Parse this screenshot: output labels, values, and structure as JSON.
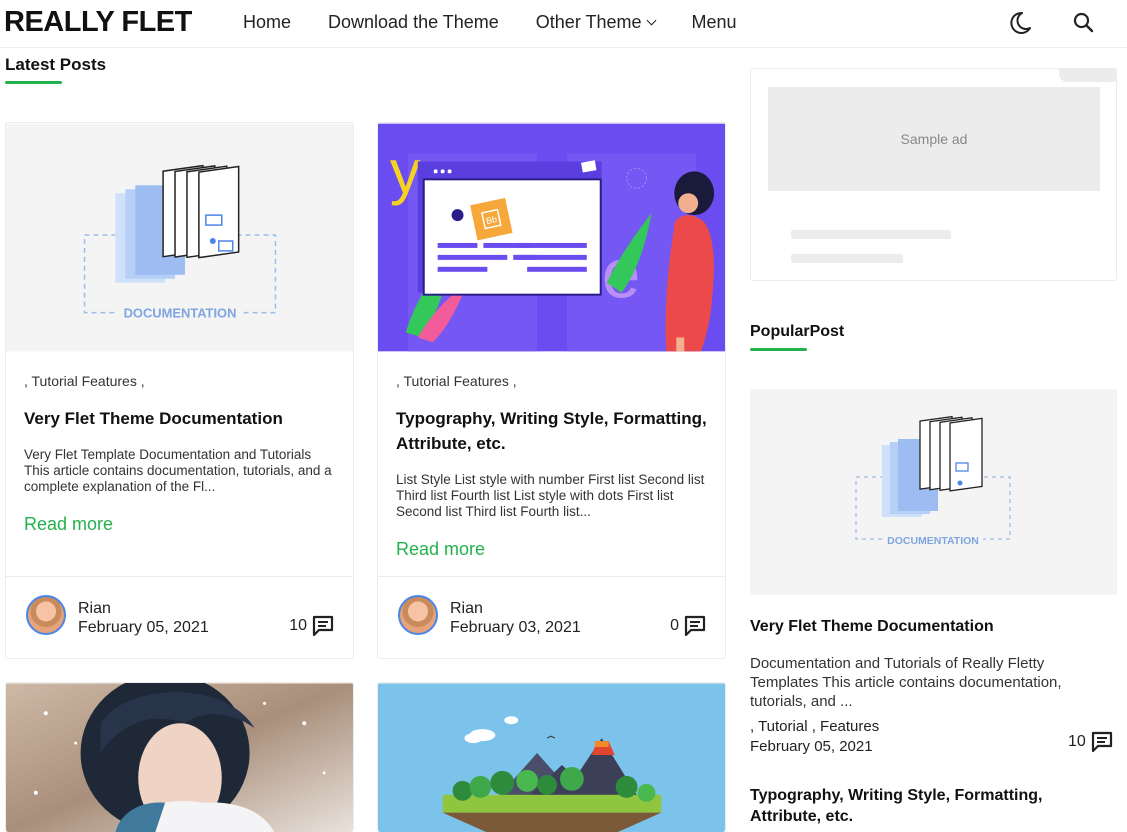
{
  "header": {
    "logo": "REALLY FLET",
    "nav": [
      "Home",
      "Download the Theme",
      "Other Theme",
      "Menu"
    ]
  },
  "latest": {
    "title": "Latest Posts"
  },
  "posts": [
    {
      "category": ", Tutorial Features ,",
      "title": "Very Flet Theme Documentation",
      "excerpt": "Very Flet Template Documentation and Tutorials This article contains documentation, tutorials, and a complete explanation of the Fl...",
      "read_more": "Read more",
      "author": "Rian",
      "date": "February 05, 2021",
      "comments": "10"
    },
    {
      "category": ", Tutorial Features ,",
      "title": "Typography, Writing Style, Formatting, Attribute, etc.",
      "excerpt": "List Style List style with number First list Second list Third list Fourth list List style with dots First list Second list Third list Fourth list...",
      "read_more": "Read more",
      "author": "Rian",
      "date": "February 03, 2021",
      "comments": "0"
    }
  ],
  "sidebar": {
    "ad_label": "Sample ad",
    "popular_title": "PopularPost",
    "popular": [
      {
        "title": "Very Flet Theme Documentation",
        "excerpt": "Documentation and Tutorials of Really Fletty Templates This article contains documentation, tutorials, and ...",
        "category": ", Tutorial , Features",
        "date": "February 05, 2021",
        "comments": "10"
      },
      {
        "title": "Typography, Writing Style, Formatting, Attribute, etc."
      }
    ]
  },
  "images": {
    "doc_label": "DOCUMENTATION",
    "ui_letter_y": "y",
    "ui_letter_e": "e",
    "ui_badge": "Bb"
  },
  "colors": {
    "accent": "#23b14d",
    "purple": "#6b4cf0",
    "sky": "#7cc3ec"
  },
  "icons": [
    "moon-icon",
    "search-icon",
    "comment-icon",
    "chevron-down-icon"
  ]
}
